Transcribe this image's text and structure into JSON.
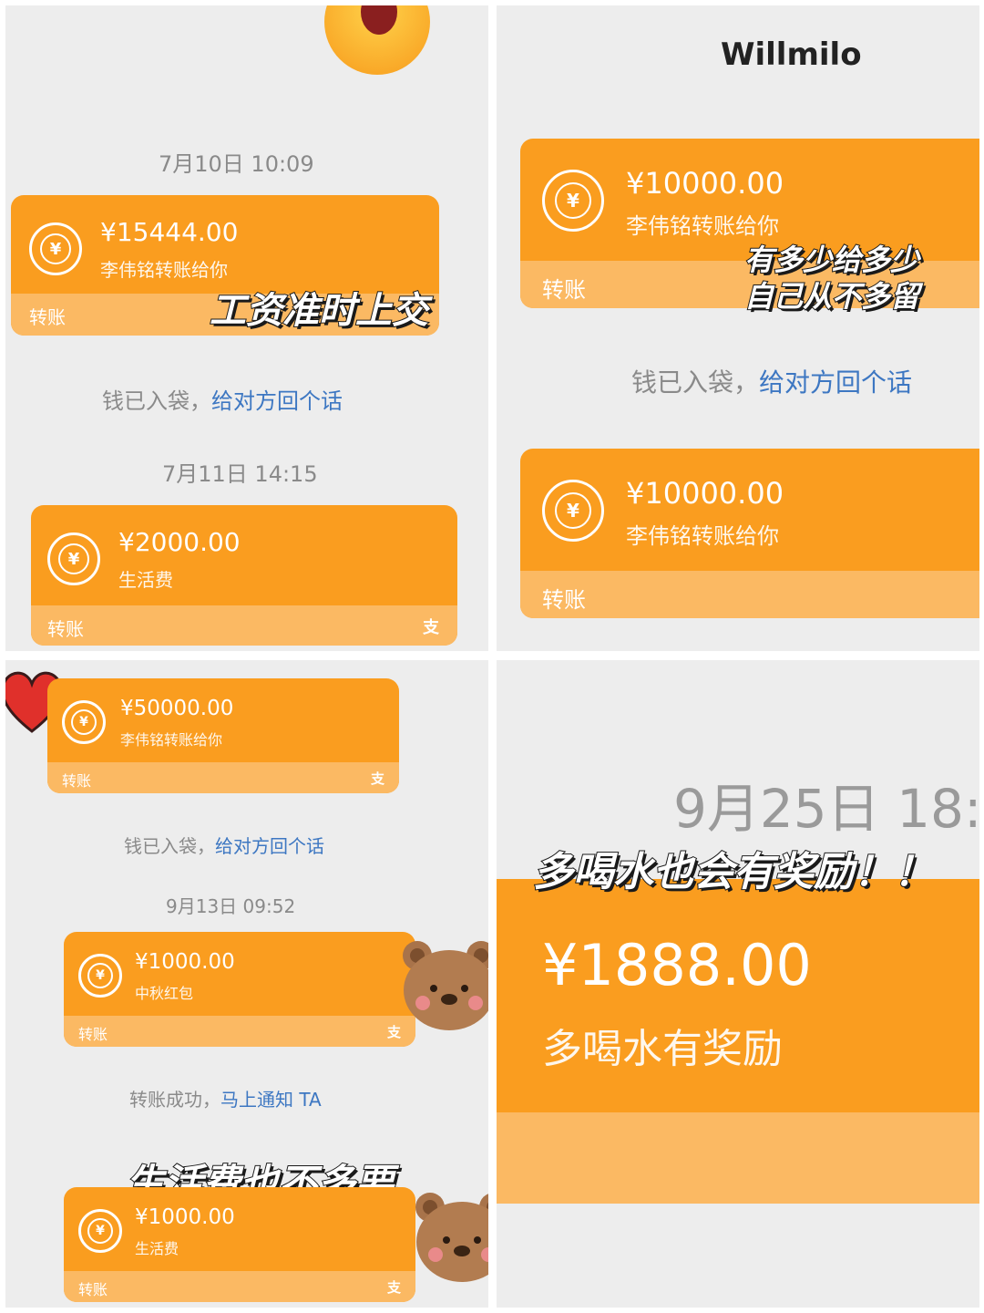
{
  "panel1": {
    "timestamp1": "7月10日 10:09",
    "card1": {
      "amount": "¥15444.00",
      "desc": "李伟铭转账给你",
      "footer": "转账"
    },
    "caption": "工资准时上交",
    "note": {
      "text": "钱已入袋，",
      "link": "给对方回个话"
    },
    "timestamp2": "7月11日 14:15",
    "card2": {
      "amount": "¥2000.00",
      "desc": "生活费",
      "footer": "转账",
      "pay_icon": "支"
    }
  },
  "panel2": {
    "title": "Willmilo",
    "card1": {
      "amount": "¥10000.00",
      "desc": "李伟铭转账给你",
      "footer": "转账"
    },
    "caption_line1": "有多少给多少",
    "caption_line2": "自己从不多留",
    "note": {
      "text": "钱已入袋，",
      "link": "给对方回个话"
    },
    "card2": {
      "amount": "¥10000.00",
      "desc": "李伟铭转账给你",
      "footer": "转账"
    }
  },
  "panel3": {
    "card1": {
      "amount": "¥50000.00",
      "desc": "李伟铭转账给你",
      "footer": "转账",
      "pay_icon": "支"
    },
    "note1": {
      "text": "钱已入袋，",
      "link": "给对方回个话"
    },
    "timestamp": "9月13日 09:52",
    "card2": {
      "amount": "¥1000.00",
      "desc": "中秋红包",
      "footer": "转账",
      "pay_icon": "支"
    },
    "note2": {
      "text": "转账成功，",
      "link": "马上通知 TA"
    },
    "caption": "生活费也不多要",
    "card3": {
      "amount": "¥1000.00",
      "desc": "生活费",
      "footer": "转账",
      "pay_icon": "支"
    }
  },
  "panel4": {
    "timestamp": "9月25日 18:",
    "caption": "多喝水也会有奖励！！",
    "card": {
      "amount": "¥1888.00",
      "desc": "多喝水有奖励"
    }
  },
  "colors": {
    "card": "#fa9d1f",
    "card_footer": "#fbb963",
    "link": "#3d77c2",
    "panel_bg": "#ededed"
  }
}
